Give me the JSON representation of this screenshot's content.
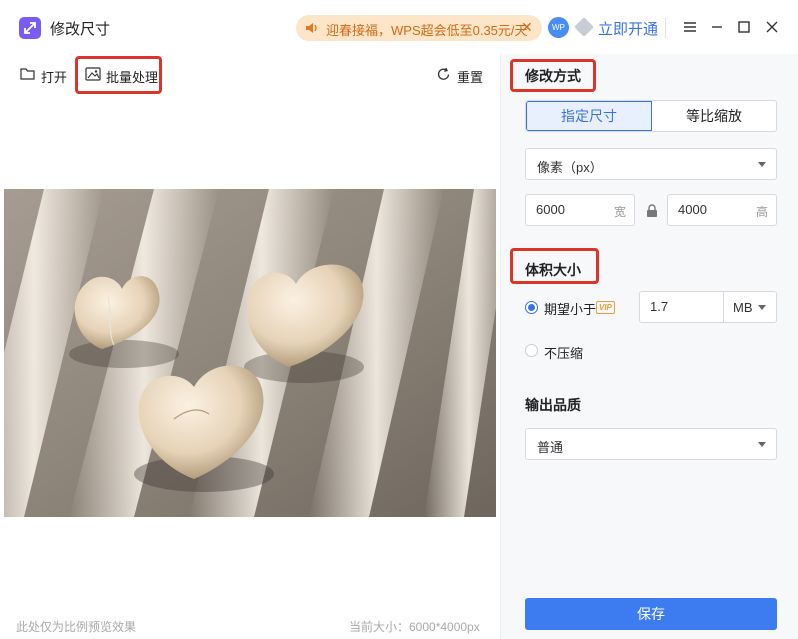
{
  "titlebar": {
    "app_title": "修改尺寸",
    "promo_text": "迎春接福，WPS超会低至0.35元/天",
    "avatar_text": "WP",
    "open_vip_label": "立即开通",
    "accent_color": "#3a72e8",
    "promo_color": "#d06b19"
  },
  "toolbar": {
    "open_label": "打开",
    "batch_label": "批量处理",
    "reset_label": "重置"
  },
  "preview": {
    "note": "此处仅为比例预览效果",
    "current_size": "当前大小：6000*4000px"
  },
  "settings": {
    "modify_mode_title": "修改方式",
    "tabs": [
      {
        "label": "指定尺寸",
        "active": true
      },
      {
        "label": "等比缩放",
        "active": false
      }
    ],
    "unit_select": "像素（px）",
    "width_value": "6000",
    "width_unit": "宽",
    "height_value": "4000",
    "height_unit": "高",
    "volume_title": "体积大小",
    "expect_less_label": "期望小于",
    "vip_badge": "VIP",
    "expect_value": "1.7",
    "expect_unit": "MB",
    "no_compress_label": "不压缩",
    "quality_title": "输出品质",
    "quality_select": "普通",
    "save_label": "保存"
  }
}
